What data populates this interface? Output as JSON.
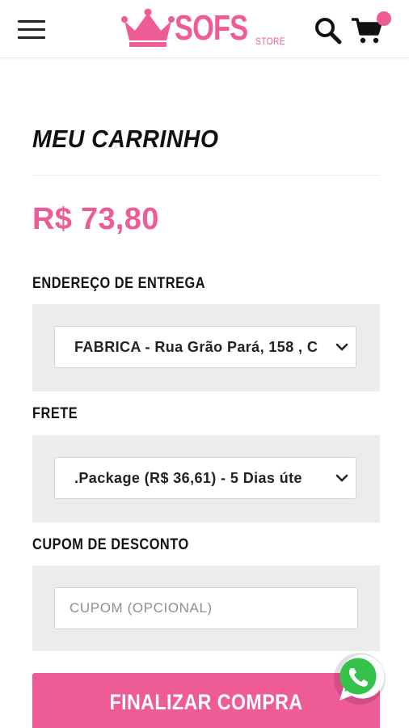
{
  "header": {
    "brand_name": "SOFS",
    "brand_sub": "STORE",
    "accent_color": "#ee5b95"
  },
  "page": {
    "title": "MEU CARRINHO",
    "total": "R$ 73,80"
  },
  "address": {
    "label": "ENDEREÇO DE ENTREGA",
    "selected": "FABRICA - Rua Grão Pará, 158 , C"
  },
  "shipping": {
    "label": "FRETE",
    "selected": ".Package (R$ 36,61) - 5 Dias úte"
  },
  "coupon": {
    "label": "CUPOM DE DESCONTO",
    "placeholder": "CUPOM (OPCIONAL)",
    "value": ""
  },
  "checkout": {
    "label": "FINALIZAR COMPRA"
  },
  "icons": {
    "menu": "hamburger-menu-icon",
    "search": "search-icon",
    "cart": "cart-icon",
    "whatsapp": "whatsapp-icon"
  }
}
